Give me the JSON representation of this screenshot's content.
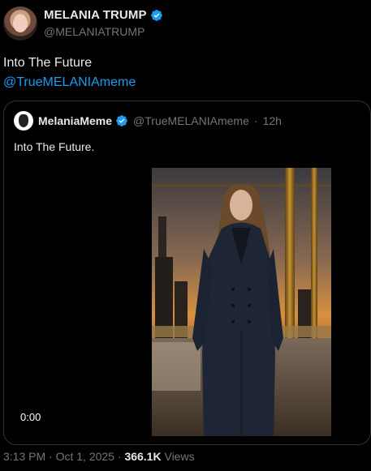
{
  "header": {
    "display_name": "MELANIA TRUMP",
    "handle": "@MELANIATRUMP"
  },
  "tweet": {
    "text": "Into The Future",
    "mention": "@TrueMELANIAmeme"
  },
  "quote": {
    "display_name": "MelaniaMeme",
    "handle": "@TrueMELANIAmeme",
    "separator": "·",
    "time_ago": "12h",
    "text": "Into The Future.",
    "video_time": "0:00"
  },
  "meta": {
    "time": "3:13 PM",
    "separator1": "·",
    "date": "Oct 1, 2025",
    "separator2": "·",
    "views_count": "366.1K",
    "views_label": "Views"
  },
  "colors": {
    "background": "#000000",
    "text": "#e7e9ea",
    "secondary": "#71767b",
    "link": "#1d9bf0",
    "verified": "#1d9bf0",
    "border": "#2f3336"
  },
  "icons": {
    "verified": "verified-badge-icon"
  }
}
